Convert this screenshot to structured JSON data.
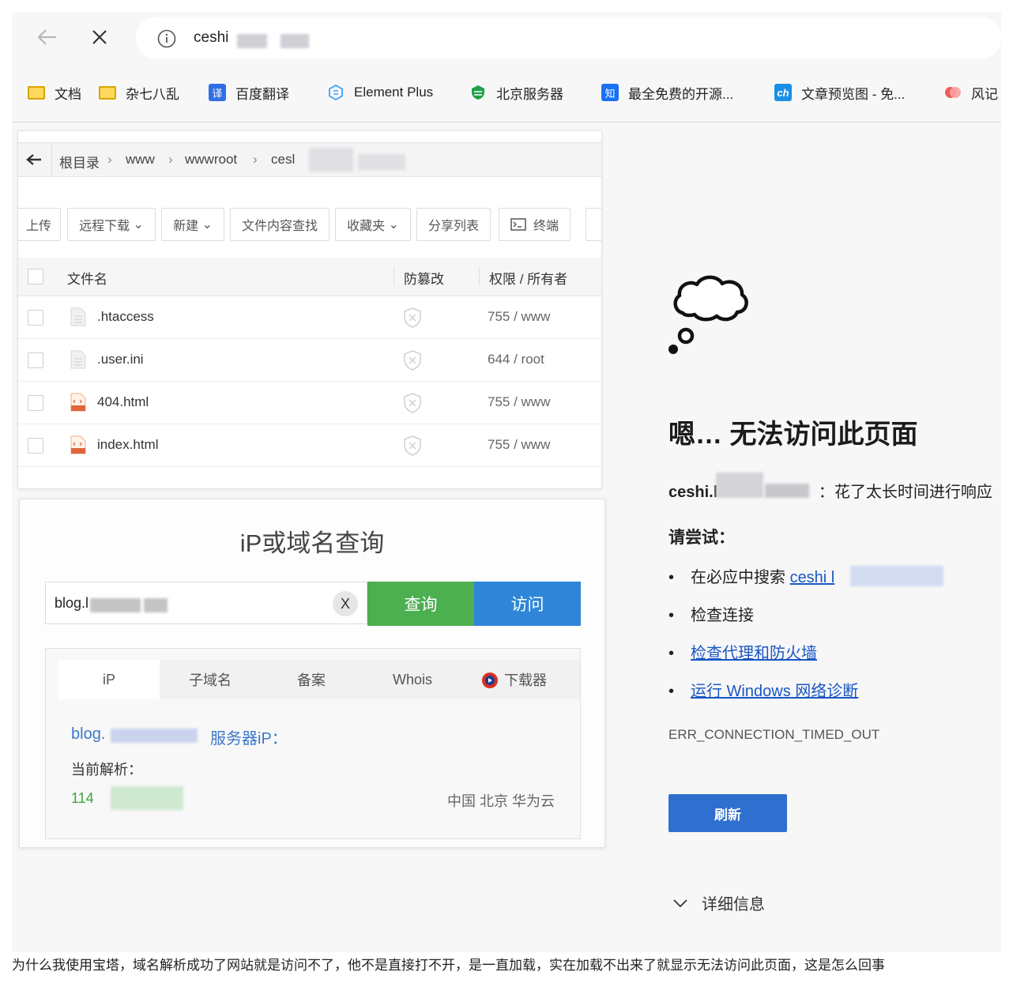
{
  "browser": {
    "address_text": "ceshi",
    "bookmarks": [
      {
        "label": "文档",
        "icon": "folder-icon"
      },
      {
        "label": "杂七八乱",
        "icon": "folder-icon"
      },
      {
        "label": "百度翻译",
        "icon": "translate-icon"
      },
      {
        "label": "Element Plus",
        "icon": "element-icon"
      },
      {
        "label": "北京服务器",
        "icon": "server-icon"
      },
      {
        "label": "最全免费的开源...",
        "icon": "zhihu-icon"
      },
      {
        "label": "文章预览图 - 免...",
        "icon": "ch-icon"
      },
      {
        "label": "风记",
        "icon": "app-icon"
      }
    ]
  },
  "file_manager": {
    "breadcrumb": [
      "根目录",
      "www",
      "wwwroot",
      "cesl"
    ],
    "toolbar": [
      "上传",
      "远程下载",
      "新建",
      "文件内容查找",
      "收藏夹",
      "分享列表",
      "终端"
    ],
    "columns": {
      "name": "文件名",
      "tamper": "防篡改",
      "perm": "权限 / 所有者"
    },
    "files": [
      {
        "name": ".htaccess",
        "perm": "755 / www",
        "type": "text"
      },
      {
        "name": ".user.ini",
        "perm": "644 / root",
        "type": "text"
      },
      {
        "name": "404.html",
        "perm": "755 / www",
        "type": "html"
      },
      {
        "name": "index.html",
        "perm": "755 / www",
        "type": "html"
      }
    ]
  },
  "ip_lookup": {
    "title": "iP或域名查询",
    "input_value": "blog.l",
    "clear_label": "X",
    "query_label": "查询",
    "visit_label": "访问",
    "tabs": [
      "iP",
      "子域名",
      "备案",
      "Whois",
      "下载器"
    ],
    "result_prefix": "blog.",
    "result_suffix": "服务器iP：",
    "current_label": "当前解析：",
    "ip_value": "114",
    "location": "中国 北京 华为云"
  },
  "error_page": {
    "title": "嗯… 无法访问此页面",
    "host": "ceshi.l",
    "message": "：花了太长时间进行响应",
    "try_label": "请尝试：",
    "suggestions": [
      {
        "prefix": "在必应中搜索 ",
        "link": "ceshi l"
      },
      {
        "prefix": "检查连接",
        "link": ""
      },
      {
        "prefix": "",
        "link": "检查代理和防火墙"
      },
      {
        "prefix": "",
        "link": "运行 Windows 网络诊断"
      }
    ],
    "error_code": "ERR_CONNECTION_TIMED_OUT",
    "refresh_label": "刷新",
    "details_label": "详细信息"
  },
  "question": "为什么我使用宝塔，域名解析成功了网站就是访问不了，他不是直接打不开，是一直加载，实在加载不出来了就显示无法访问此页面，这是怎么回事"
}
